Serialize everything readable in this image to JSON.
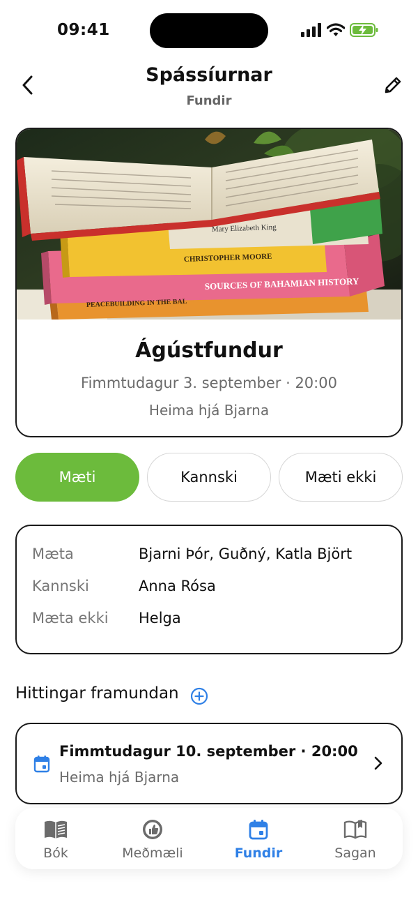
{
  "status_bar": {
    "time": "09:41"
  },
  "header": {
    "title": "Spássíurnar",
    "subtitle": "Fundir"
  },
  "meeting": {
    "name": "Ágústfundur",
    "datetime": "Fimmtudagur 3. september · 20:00",
    "location": "Heima hjá Bjarna"
  },
  "rsvp": {
    "yes": "Mæti",
    "maybe": "Kannski",
    "no": "Mæti ekki",
    "selected": "yes"
  },
  "attendance": [
    {
      "label": "Mæta",
      "value": "Bjarni Þór, Guðný, Katla Björt"
    },
    {
      "label": "Kannski",
      "value": "Anna Rósa"
    },
    {
      "label": "Mæta ekki",
      "value": "Helga"
    }
  ],
  "upcoming": {
    "title": "Hittingar framundan",
    "items": [
      {
        "title": "Fimmtudagur 10. september · 20:00",
        "location": "Heima hjá Bjarna"
      }
    ]
  },
  "tabs": [
    {
      "label": "Bók",
      "icon": "book-icon"
    },
    {
      "label": "Meðmæli",
      "icon": "recommend-icon"
    },
    {
      "label": "Fundir",
      "icon": "calendar-icon",
      "active": true
    },
    {
      "label": "Sagan",
      "icon": "open-book-icon"
    }
  ],
  "book_spines": {
    "mary": "Mary Elizabeth King",
    "moore": "CHRISTOPHER MOORE",
    "bahamian": "SOURCES OF BAHAMIAN HISTORY",
    "peace": "PEACEBUILDING IN THE BAL"
  },
  "colors": {
    "accent_green": "#6cbb3c",
    "accent_blue": "#2f80e6",
    "border": "#1a1a1a"
  }
}
